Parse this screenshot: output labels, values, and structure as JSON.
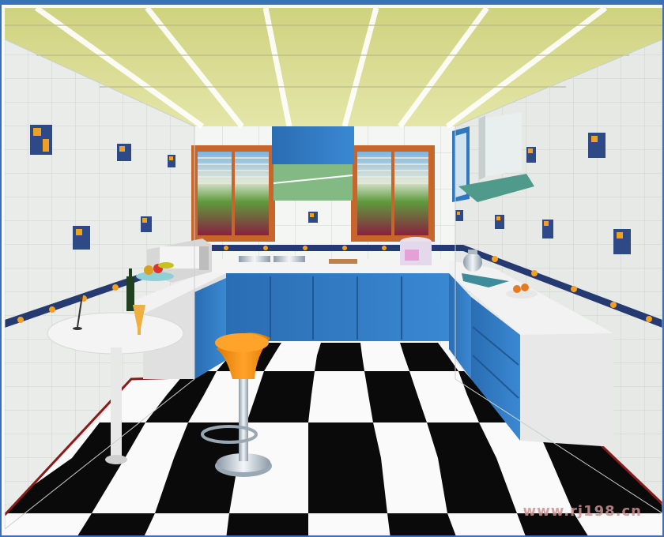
{
  "scene": {
    "watermark_text": "www.rj198.cn",
    "colors": {
      "ceiling": "#d8d98c",
      "ceiling_rail": "#ffffff",
      "wall_tile": "#f4f6f4",
      "tile_line": "#d7ddd8",
      "cabinet_blue": "#2f78c0",
      "counter_white": "#f2f2f2",
      "floor_black": "#0a0a0a",
      "floor_white": "#fafafa",
      "stool_orange": "#f08a10",
      "window_frame": "#c8652a"
    },
    "icons": [
      "tile-motif-icon",
      "microwave-icon",
      "rice-cooker-icon",
      "range-hood-icon",
      "stool-icon",
      "fruit-bowl-icon"
    ]
  }
}
